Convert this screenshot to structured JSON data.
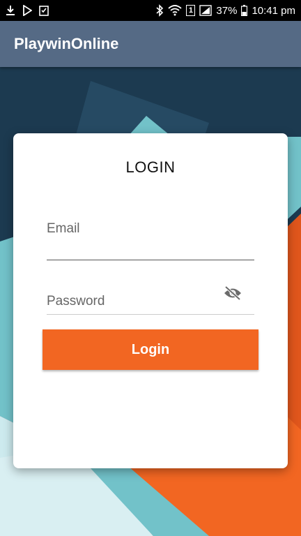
{
  "status_bar": {
    "battery": "37%",
    "time": "10:41 pm",
    "sim_badge": "1",
    "icons": [
      "download-icon",
      "play-store-icon",
      "checklist-icon",
      "bluetooth-icon",
      "wifi-icon",
      "sim-icon",
      "signal-icon",
      "battery-icon"
    ]
  },
  "app_bar": {
    "title": "PlaywinOnline"
  },
  "login_card": {
    "title": "LOGIN",
    "email_placeholder": "Email",
    "password_placeholder": "Password",
    "password_toggle_icon": "eye-off-icon",
    "login_button": "Login"
  },
  "colors": {
    "status_bar": "#000000",
    "app_bar": "#556a85",
    "background_dark": "#1c3a50",
    "accent_orange": "#f26622",
    "accent_teal": "#72c2c9",
    "card": "#ffffff"
  }
}
